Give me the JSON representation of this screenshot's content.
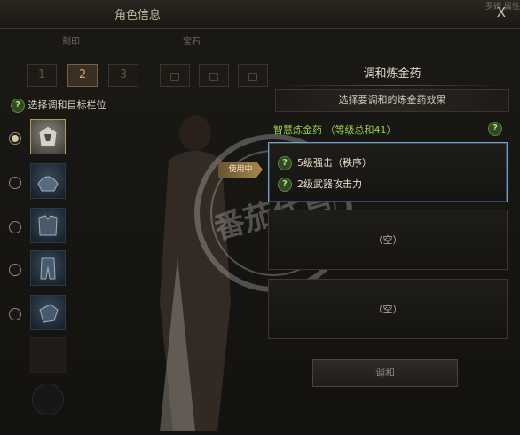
{
  "window": {
    "title": "角色信息",
    "close_glyph": "X",
    "corner_text": "罗姆 属性"
  },
  "left_tabs": [
    "刻印",
    "宝石"
  ],
  "pages": [
    "1",
    "2",
    "3"
  ],
  "left": {
    "select_label": "选择调和目标栏位",
    "help_glyph": "?"
  },
  "slots": [
    {
      "name": "helmet-slot",
      "selected": true
    },
    {
      "name": "shoulder-slot",
      "selected": false
    },
    {
      "name": "chest-slot",
      "selected": false
    },
    {
      "name": "pants-slot",
      "selected": false
    },
    {
      "name": "gloves-slot",
      "selected": false
    }
  ],
  "right": {
    "title": "调和炼金药",
    "close_glyph": "X",
    "subtitle": "选择要调和的炼金药效果",
    "potion_label": "智慧炼金药 （等级总和41）",
    "in_use_tag": "使用中",
    "effects": [
      "5级强击（秩序）",
      "2级武器攻击力"
    ],
    "empty_label_1": "（空）",
    "empty_label_2": "（空）",
    "mix_button": "调和",
    "help_glyph": "?"
  },
  "watermark": {
    "text": "番茄代售"
  },
  "colors": {
    "potion_green": "#9bd04a",
    "active_border": "#7a9fc0",
    "gold": "#c9a86c"
  }
}
